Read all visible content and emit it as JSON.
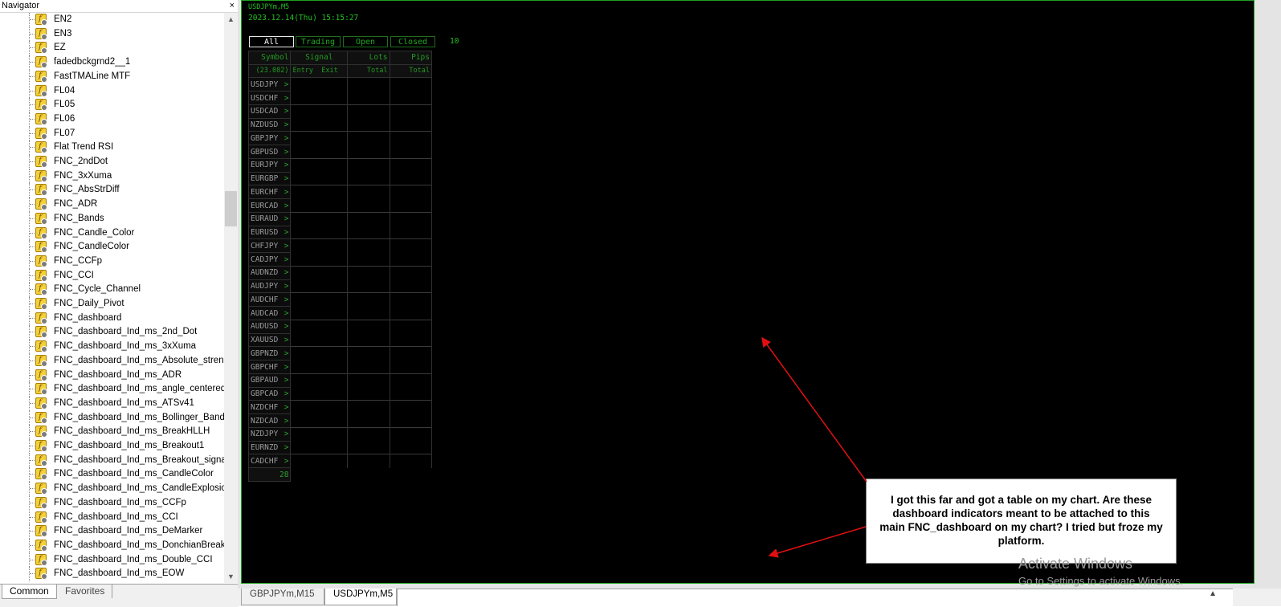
{
  "navigator": {
    "title": "Navigator",
    "close": "×",
    "items": [
      "EN2",
      "EN3",
      "EZ",
      "fadedbckgrnd2__1",
      "FastTMALine MTF",
      "FL04",
      "FL05",
      "FL06",
      "FL07",
      "Flat Trend RSI",
      "FNC_2ndDot",
      "FNC_3xXuma",
      "FNC_AbsStrDiff",
      "FNC_ADR",
      "FNC_Bands",
      "FNC_Candle_Color",
      "FNC_CandleColor",
      "FNC_CCFp",
      "FNC_CCI",
      "FNC_Cycle_Channel",
      "FNC_Daily_Pivot",
      "FNC_dashboard",
      "FNC_dashboard_Ind_ms_2nd_Dot",
      "FNC_dashboard_Ind_ms_3xXuma",
      "FNC_dashboard_Ind_ms_Absolute_streng",
      "FNC_dashboard_Ind_ms_ADR",
      "FNC_dashboard_Ind_ms_angle_centered_",
      "FNC_dashboard_Ind_ms_ATSv41",
      "FNC_dashboard_Ind_ms_Bollinger_Band_",
      "FNC_dashboard_Ind_ms_BreakHLLH",
      "FNC_dashboard_Ind_ms_Breakout1",
      "FNC_dashboard_Ind_ms_Breakout_signal",
      "FNC_dashboard_Ind_ms_CandleColor",
      "FNC_dashboard_Ind_ms_CandleExplosion",
      "FNC_dashboard_Ind_ms_CCFp",
      "FNC_dashboard_Ind_ms_CCI",
      "FNC_dashboard_Ind_ms_DeMarker",
      "FNC_dashboard_Ind_ms_DonchianBreako",
      "FNC_dashboard_Ind_ms_Double_CCI",
      "FNC_dashboard_Ind_ms_EOW"
    ],
    "tabs": {
      "common": "Common",
      "favorites": "Favorites"
    },
    "scroll_up": "▲",
    "scroll_down": "▼"
  },
  "chart": {
    "symbol": "USDJPYm,M5",
    "datetime": "2023.12.14(Thu) 15:15:27",
    "filters": {
      "all": "All",
      "trading": "Trading",
      "open": "Open",
      "closed": "Closed"
    },
    "count": "10",
    "table": {
      "headers": [
        "Symbol",
        "Signal",
        "Lots",
        "Pips"
      ],
      "subheaders": [
        "(23.082)",
        "Entry  Exit",
        "Total",
        "Total"
      ],
      "rows": [
        "USDJPY",
        "USDCHF",
        "USDCAD",
        "NZDUSD",
        "GBPJPY",
        "GBPUSD",
        "EURJPY",
        "EURGBP",
        "EURCHF",
        "EURCAD",
        "EURAUD",
        "EURUSD",
        "CHFJPY",
        "CADJPY",
        "AUDNZD",
        "AUDJPY",
        "AUDCHF",
        "AUDCAD",
        "AUDUSD",
        "XAUUSD",
        "GBPNZD",
        "GBPCHF",
        "GBPAUD",
        "GBPCAD",
        "NZDCHF",
        "NZDCAD",
        "NZDJPY",
        "EURNZD",
        "CADCHF"
      ],
      "arrow": ">",
      "footer": "28"
    },
    "colors": {
      "background": "#000000",
      "text": "#22c022",
      "grid": "#1f9f1f"
    }
  },
  "annotation": {
    "text": "I got this far and got a table on my chart. Are these dashboard indicators meant to be attached to this main FNC_dashboard on my chart? I tried but froze my  platform."
  },
  "watermark": {
    "title": "Activate Windows",
    "subtitle": "Go to Settings to activate Windows."
  },
  "chart_tabs": [
    "GBPJPYm,M15",
    "USDJPYm,M5"
  ],
  "chart_tab_scroll": "▲"
}
